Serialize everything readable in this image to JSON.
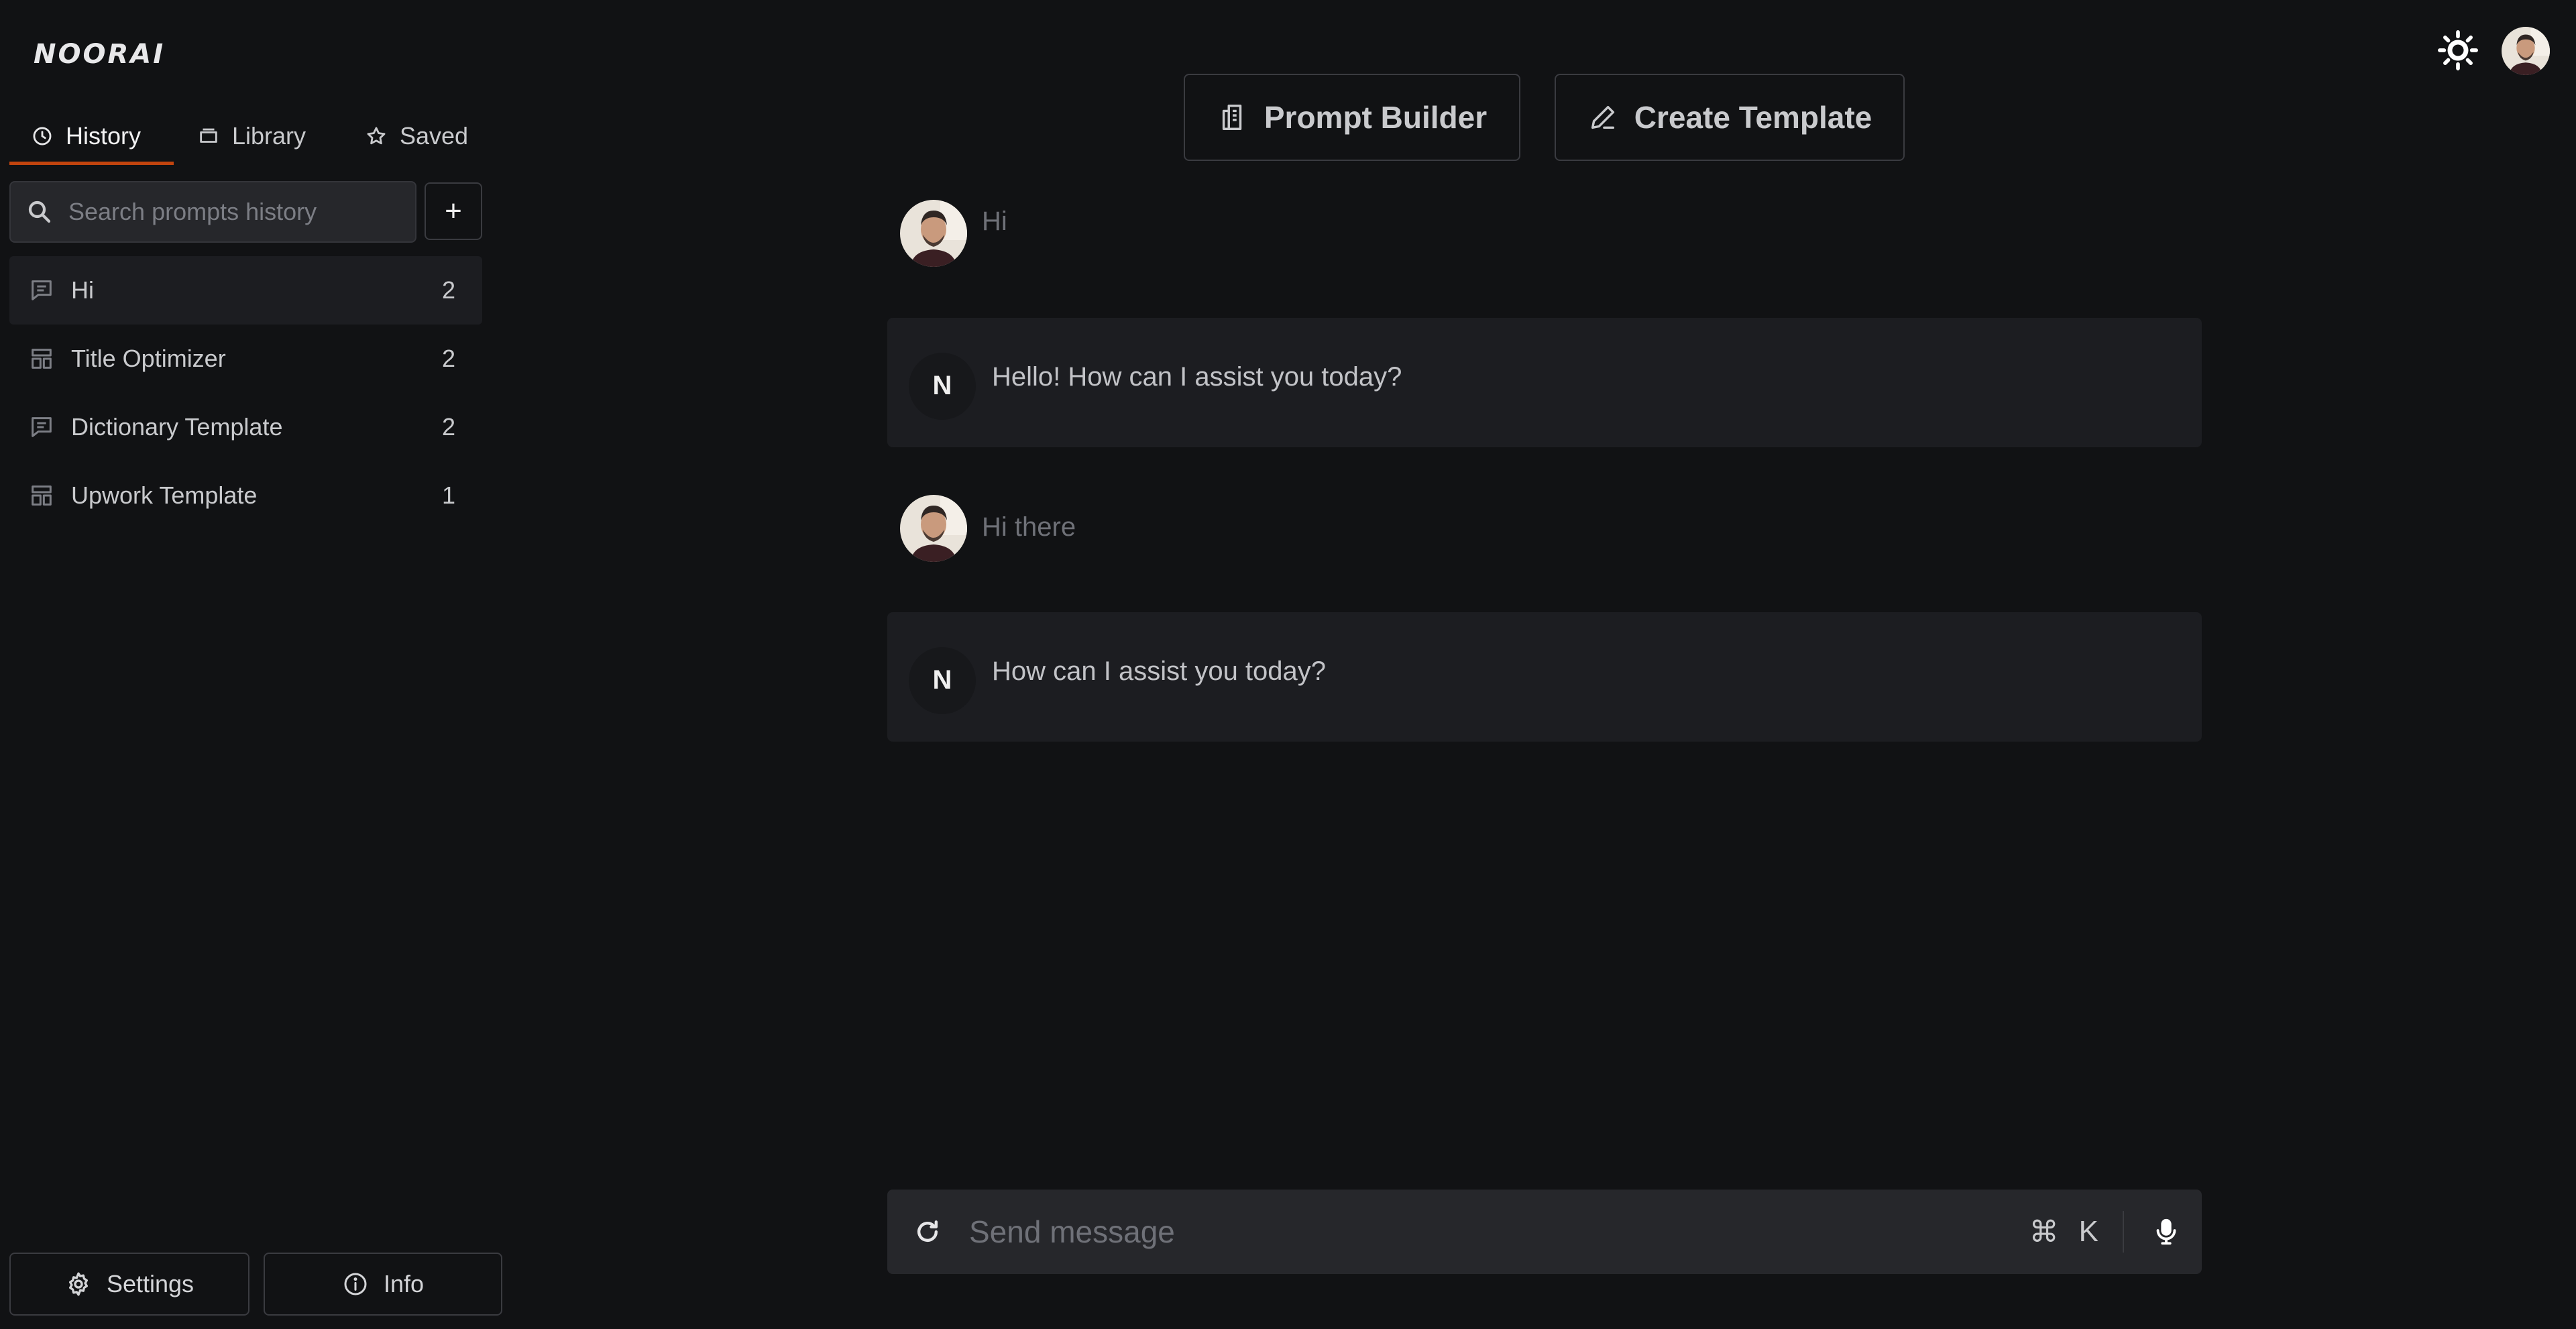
{
  "app": {
    "logo": "NOORAI"
  },
  "sidebar": {
    "tabs": [
      {
        "label": "History",
        "icon": "clock-icon",
        "active": true
      },
      {
        "label": "Library",
        "icon": "folder-icon",
        "active": false
      },
      {
        "label": "Saved",
        "icon": "star-icon",
        "active": false
      }
    ],
    "search": {
      "placeholder": "Search prompts history"
    },
    "add_label": "+",
    "history": [
      {
        "label": "Hi",
        "count": "2",
        "icon": "chat-icon",
        "active": true
      },
      {
        "label": "Title Optimizer",
        "count": "2",
        "icon": "template-icon",
        "active": false
      },
      {
        "label": "Dictionary Template",
        "count": "2",
        "icon": "chat-icon",
        "active": false
      },
      {
        "label": "Upwork Template",
        "count": "1",
        "icon": "template-icon",
        "active": false
      }
    ],
    "settings_label": "Settings",
    "info_label": "Info"
  },
  "header": {
    "prompt_builder_label": "Prompt Builder",
    "create_template_label": "Create Template"
  },
  "chat": {
    "messages": [
      {
        "role": "user",
        "text": "Hi"
      },
      {
        "role": "assistant",
        "avatar_letter": "N",
        "text": "Hello! How can I assist you today?"
      },
      {
        "role": "user",
        "text": "Hi there"
      },
      {
        "role": "assistant",
        "avatar_letter": "N",
        "text": "How can I assist you today?"
      }
    ]
  },
  "composer": {
    "placeholder": "Send message",
    "shortcut_symbol": "⌘",
    "shortcut_key": "K"
  },
  "colors": {
    "background": "#111214",
    "accent": "#c2440e",
    "bubble": "#1c1d21",
    "input": "#26272b"
  }
}
